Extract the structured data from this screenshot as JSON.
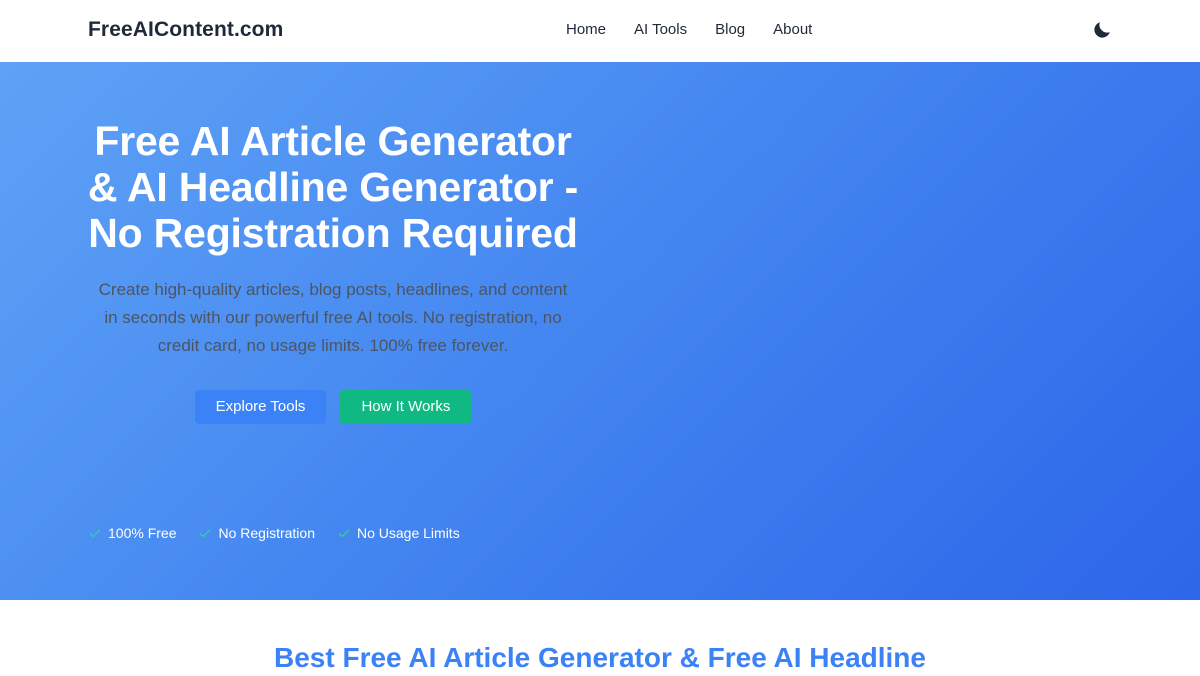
{
  "header": {
    "logo": "FreeAIContent.com",
    "nav": [
      "Home",
      "AI Tools",
      "Blog",
      "About"
    ],
    "theme_toggle_icon": "moon-icon"
  },
  "hero": {
    "title": "Free AI Article Generator & AI Headline Generator - No Registration Required",
    "subtitle": "Create high-quality articles, blog posts, headlines, and content in seconds with our powerful free AI tools. No registration, no credit card, no usage limits. 100% free forever.",
    "buttons": {
      "primary": "Explore Tools",
      "secondary": "How It Works"
    },
    "features": [
      "100% Free",
      "No Registration",
      "No Usage Limits"
    ],
    "feature_icon": "check-icon"
  },
  "section": {
    "title": "Best Free AI Article Generator & Free AI Headline"
  },
  "colors": {
    "hero_gradient_start": "#5ea2f6",
    "hero_gradient_end": "#2e66e8",
    "primary_button": "#3b82f6",
    "secondary_button": "#10b981",
    "check": "#34d399",
    "section_title": "#3b82f6",
    "text_dark": "#1f2937"
  }
}
